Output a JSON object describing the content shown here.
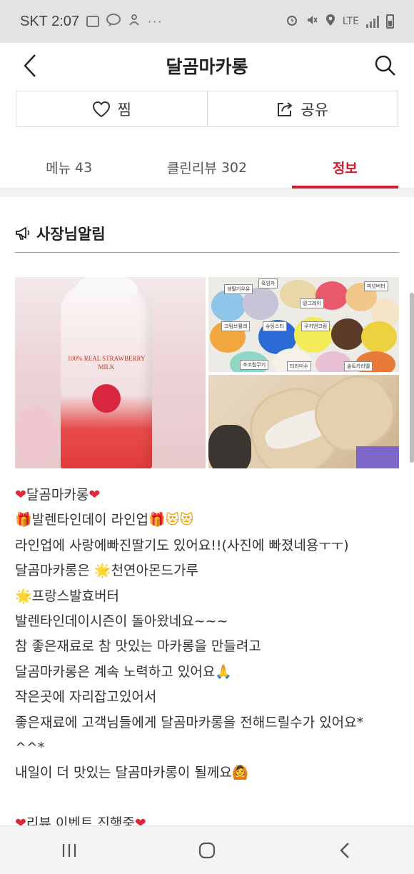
{
  "status_bar": {
    "carrier_time": "SKT 2:07",
    "dots": "···",
    "network": "LTE"
  },
  "header": {
    "title": "달곰마카롱"
  },
  "actions": {
    "like_label": "찜",
    "share_label": "공유"
  },
  "tabs": [
    {
      "label": "메뉴",
      "count": "43"
    },
    {
      "label": "클린리뷰",
      "count": "302"
    },
    {
      "label": "정보",
      "count": ""
    }
  ],
  "notice": {
    "title": "사장님알림"
  },
  "photo": {
    "bottle_label": "100% REAL STRAWBERRY MILK",
    "macaron_tags": [
      "생딸기우유",
      "흑임자",
      "얼그레이",
      "피넛버터",
      "크림브륄레",
      "슈팅스타",
      "쿠키앤크림",
      "초코칩쿠키",
      "티라미수",
      "솔트카라멜"
    ]
  },
  "post": {
    "lines": [
      {
        "prefix": "❤",
        "text": "달곰마카롱",
        "suffix": "❤"
      },
      {
        "prefix": "🎁",
        "text": "발렌타인데이 라인업",
        "suffix": "🎁😻😻"
      },
      {
        "prefix": "",
        "text": "라인업에 사랑에빠진딸기도 있어요!!(사진에 빠졌네용ㅜㅜ)",
        "suffix": ""
      },
      {
        "prefix": "",
        "text": "달곰마카롱은 ",
        "suffix": "🌟천연아몬드가루"
      },
      {
        "prefix": "🌟",
        "text": "프랑스발효버터",
        "suffix": ""
      },
      {
        "prefix": "",
        "text": "발렌타인데이시즌이 돌아왔네요~~~",
        "suffix": ""
      },
      {
        "prefix": "",
        "text": "참 좋은재료로 참 맛있는 마카롱을 만들려고",
        "suffix": ""
      },
      {
        "prefix": "",
        "text": "달곰마카롱은 계속 노력하고 있어요",
        "suffix": "🙏"
      },
      {
        "prefix": "",
        "text": "작은곳에 자리잡고있어서",
        "suffix": ""
      },
      {
        "prefix": "",
        "text": "좋은재료에 고객님들에게 달곰마카롱을 전해드릴수가 있어요*",
        "suffix": ""
      },
      {
        "prefix": "",
        "text": "^^*",
        "suffix": ""
      },
      {
        "prefix": "",
        "text": "내일이 더 맛있는 달곰마카롱이 될께요",
        "suffix": "🙆"
      },
      {
        "prefix": "",
        "text": "",
        "suffix": ""
      },
      {
        "prefix": "❤",
        "text": "리뷰 이벤트 진행중",
        "suffix": "❤"
      }
    ]
  },
  "colors": {
    "accent": "#d01c2d",
    "status_bar_bg": "#e3e3e3"
  }
}
